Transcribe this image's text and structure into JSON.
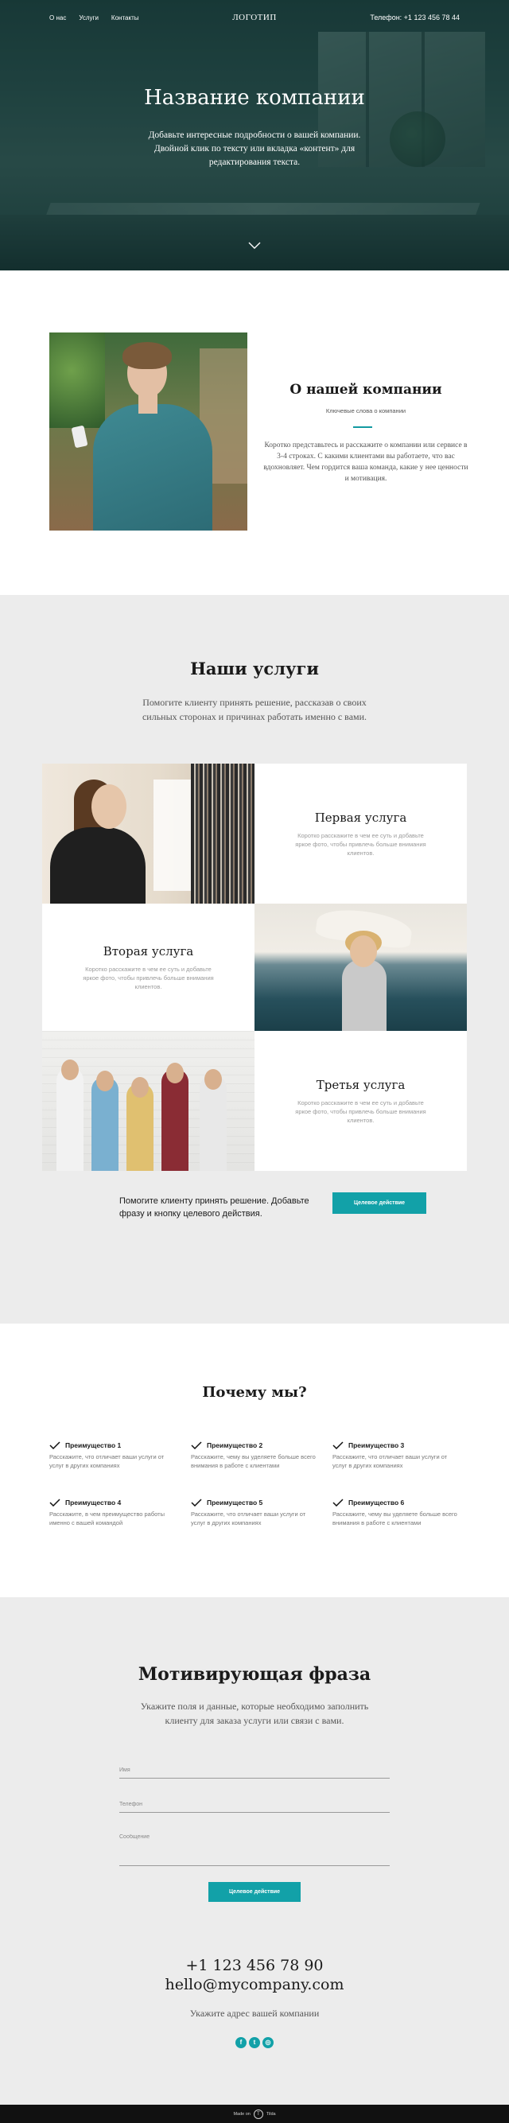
{
  "nav": {
    "items": [
      "О нас",
      "Услуги",
      "Контакты"
    ],
    "logo": "ЛОГОТИП",
    "phone": "Телефон: +1 123 456 78 44"
  },
  "hero": {
    "title": "Название компании",
    "subtitle": "Добавьте интересные подробности о вашей компании. Двойной клик по тексту или вкладка «контент» для редактирования текста.",
    "chevron_icon": "chevron-down-icon"
  },
  "about": {
    "title": "О нашей компании",
    "keywords": "Ключевые слова о компании",
    "text": "Коротко представьтесь и расскажите о компании или сервисе в 3-4 строках. С какими клиентами вы работаете, что вас вдохновляет. Чем гордится ваша команда, какие у нее ценности и мотивация."
  },
  "services": {
    "title": "Наши услуги",
    "subtitle": "Помогите клиенту принять решение, рассказав о своих сильных сторонах и причинах работать именно с вами.",
    "items": [
      {
        "name": "Первая услуга",
        "desc": "Коротко расскажите в чем ее суть и добавьте яркое фото, чтобы привлечь больше внимания клиентов."
      },
      {
        "name": "Вторая услуга",
        "desc": "Коротко расскажите в чем ее суть и добавьте яркое фото, чтобы привлечь больше внимания клиентов."
      },
      {
        "name": "Третья услуга",
        "desc": "Коротко расскажите в чем ее суть и добавьте яркое фото, чтобы привлечь больше внимания клиентов."
      }
    ],
    "cta_text": "Помогите клиенту принять решение. Добавьте фразу и кнопку целевого действия.",
    "cta_button": "Целевое действие"
  },
  "why": {
    "title": "Почему мы?",
    "advantages": [
      {
        "title": "Преимущество 1",
        "text": "Расскажите, что отличает ваши услуги от услуг в других компаниях"
      },
      {
        "title": "Преимущество 2",
        "text": "Расскажите, чему вы уделяете больше всего внимания в работе с клиентами"
      },
      {
        "title": "Преимущество 3",
        "text": "Расскажите, что отличает ваши услуги от услуг в других компаниях"
      },
      {
        "title": "Преимущество 4",
        "text": "Расскажите, в чем преимущество работы именно с вашей командой"
      },
      {
        "title": "Преимущество 5",
        "text": "Расскажите, что отличает ваши услуги от услуг в других компаниях"
      },
      {
        "title": "Преимущество 6",
        "text": "Расскажите, чему вы уделяете больше всего внимания в работе с клиентами"
      }
    ]
  },
  "contact": {
    "title": "Мотивирующая фраза",
    "subtitle": "Укажите поля и данные, которые необходимо заполнить клиенту для заказа услуги или связи с вами.",
    "fields": {
      "name_placeholder": "Имя",
      "phone_placeholder": "Телефон",
      "message_placeholder": "Сообщение"
    },
    "submit": "Целевое действие",
    "phone": "+1 123 456 78 90",
    "email": "hello@mycompany.com",
    "address": "Укажите адрес вашей компании",
    "socials": [
      {
        "icon": "facebook-icon",
        "glyph": "f"
      },
      {
        "icon": "twitter-icon",
        "glyph": "t"
      },
      {
        "icon": "instagram-icon",
        "glyph": "◎"
      }
    ]
  },
  "footer": {
    "made_on": "Made on",
    "tilda_glyph": "T",
    "brand": "Tilda"
  },
  "colors": {
    "accent": "#12a1a8",
    "section_gray": "#ececec",
    "footer_bg": "#111111"
  }
}
